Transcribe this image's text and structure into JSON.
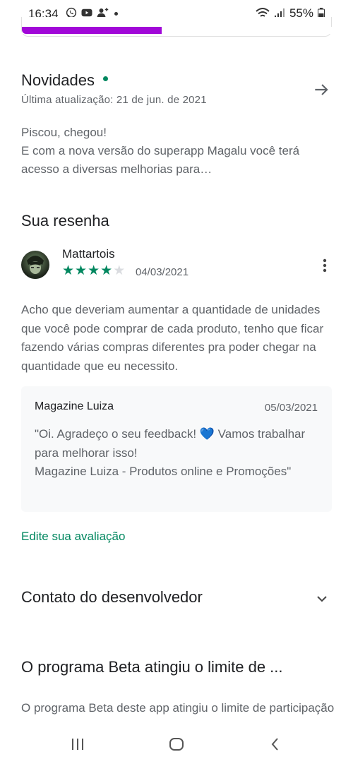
{
  "status_bar": {
    "time": "16:34",
    "battery": "55%"
  },
  "install_progress": {
    "fraction": 0.45,
    "color": "#a108d8"
  },
  "whats_new": {
    "title": "Novidades",
    "updated": "Última atualização: 21 de jun. de 2021",
    "body_line1": "Piscou, chegou!",
    "body_line2": "E com a nova versão do superapp Magalu você terá acesso a diversas melhorias para…"
  },
  "my_review": {
    "title": "Sua resenha",
    "reviewer": "Mattartois",
    "rating": 4,
    "max_rating": 5,
    "date": "04/03/2021",
    "body": "Acho que deveriam aumentar a quantidade de unidades que você pode comprar de cada produto, tenho que ficar fazendo várias compras diferentes pra poder chegar na quantidade que eu necessito.",
    "reply": {
      "author": "Magazine Luiza",
      "date": "05/03/2021",
      "body": "\"Oi. Agradeço o seu feedback! 💙 Vamos trabalhar para melhorar isso!\nMagazine Luiza - Produtos online e Promoções\""
    },
    "edit_label": "Edite sua avaliação"
  },
  "developer_contact": {
    "title": "Contato do desenvolvedor"
  },
  "beta": {
    "title": "O programa Beta atingiu o limite de ...",
    "body": "O programa Beta deste app atingiu o limite de participação"
  },
  "colors": {
    "accent_green": "#01875f",
    "progress_purple": "#a108d8"
  },
  "icons": {
    "news_arrow": "arrow-right-icon",
    "more": "more-vert-icon",
    "expand": "chevron-down-icon"
  }
}
